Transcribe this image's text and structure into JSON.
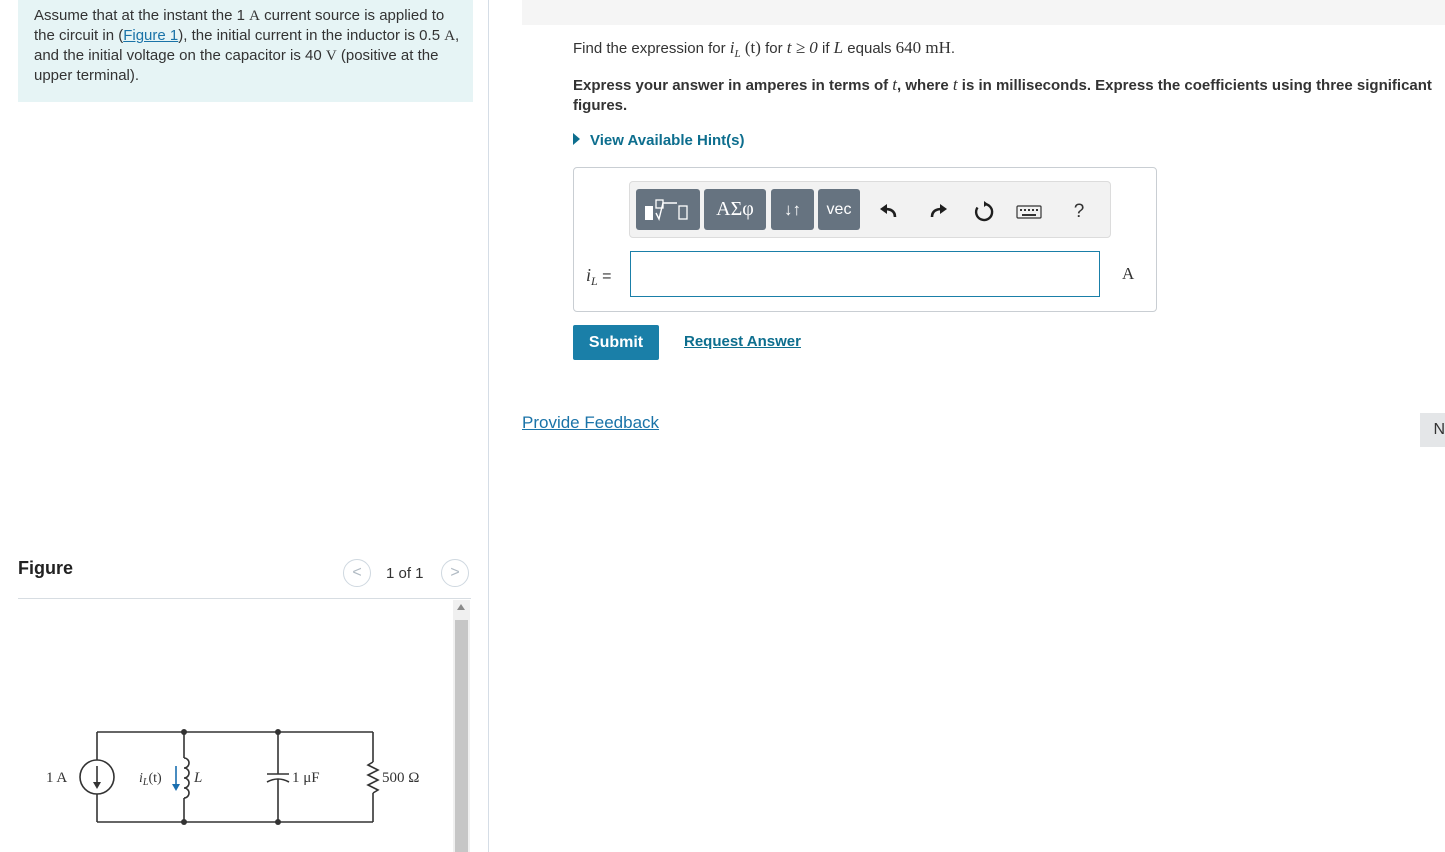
{
  "intro": {
    "part1": "Assume that at the instant the 1 ",
    "unit_A": "A",
    "part2": " current source is applied to the circuit in (",
    "figure_link": "Figure 1",
    "part3": "), the initial current in the inductor is 0.5 ",
    "unit_A2": "A",
    "part4": ", and the initial voltage on the capacitor is 40 ",
    "unit_V": "V",
    "part5": " (positive at the upper terminal)."
  },
  "figure": {
    "title": "Figure",
    "counter": "1 of 1",
    "prev_glyph": "<",
    "next_glyph": ">",
    "circuit": {
      "source_label": "1 A",
      "inductor_current_label": "i",
      "inductor_current_sub": "L",
      "inductor_current_arg": "(t)",
      "inductor_label": "L",
      "capacitor_label": "1 μF",
      "resistor_label": "500 Ω"
    }
  },
  "question": {
    "prefix": "Find the expression for ",
    "var_i": "i",
    "var_sub": "L",
    "var_arg": " (t)",
    "mid1": " for ",
    "cond": "t ≥ 0",
    "mid2": " if ",
    "var_L": "L",
    "mid3": " equals ",
    "value": "640 mH",
    "suffix": "."
  },
  "instruction": {
    "part1": "Express your answer in amperes in terms of ",
    "t1": "t",
    "part2": ", where ",
    "t2": "t",
    "part3": " is in milliseconds. Express the coefficients using three significant figures."
  },
  "hints_label": "View Available Hint(s)",
  "toolbar": {
    "greek_label": "ΑΣφ",
    "arrows_label": "↓↑",
    "vec_label": "vec",
    "help_label": "?"
  },
  "answer": {
    "var_i": "i",
    "var_sub": "L",
    "equals": " =",
    "value": "",
    "unit": "A"
  },
  "actions": {
    "submit": "Submit",
    "request_answer": "Request Answer",
    "feedback": "Provide Feedback",
    "next": "N"
  }
}
